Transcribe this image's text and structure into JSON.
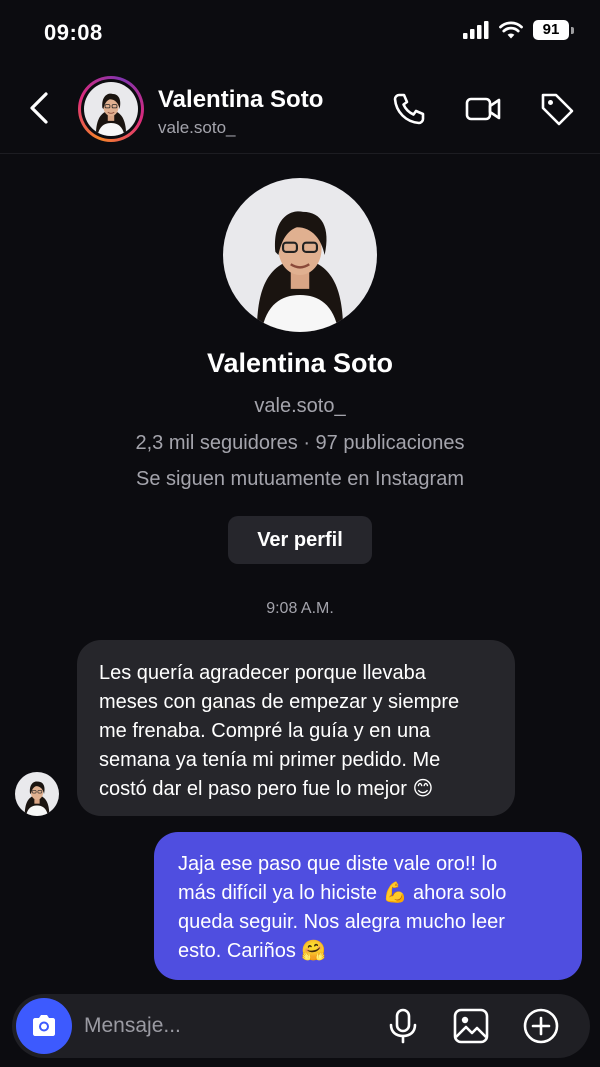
{
  "status_bar": {
    "time": "09:08",
    "battery": "91"
  },
  "header": {
    "name": "Valentina Soto",
    "handle": "vale.soto_"
  },
  "profile": {
    "name": "Valentina Soto",
    "handle": "vale.soto_",
    "stats": "2,3 mil seguidores · 97 publicaciones",
    "mutual": "Se siguen mutuamente en Instagram",
    "view_profile_label": "Ver perfil"
  },
  "messages": {
    "timestamp": "9:08 A.M.",
    "incoming_lines": [
      "Les quería agradecer porque llevaba",
      "meses con ganas de empezar y siempre",
      "me frenaba. Compré la guía y en una",
      "semana ya tenía mi primer pedido. Me",
      "costó dar el paso pero fue lo mejor 😊"
    ],
    "outgoing_lines": [
      "Jaja ese paso que diste vale oro!! lo",
      "más difícil ya lo hiciste 💪 ahora solo",
      "queda seguir. Nos alegra mucho leer",
      "esto. Cariños 🤗"
    ]
  },
  "composer": {
    "placeholder": "Mensaje..."
  },
  "icons": {
    "back": "chevron-left-icon",
    "call": "phone-icon",
    "video": "video-camera-icon",
    "tag": "tag-icon",
    "camera": "camera-icon",
    "mic": "microphone-icon",
    "gallery": "image-icon",
    "add": "plus-circle-icon"
  },
  "colors": {
    "background": "#0c0c10",
    "incoming_bubble": "#26262b",
    "outgoing_bubble": "#4f4ee0",
    "camera_button": "#3d5afe",
    "secondary_text": "#a4a4ac"
  }
}
